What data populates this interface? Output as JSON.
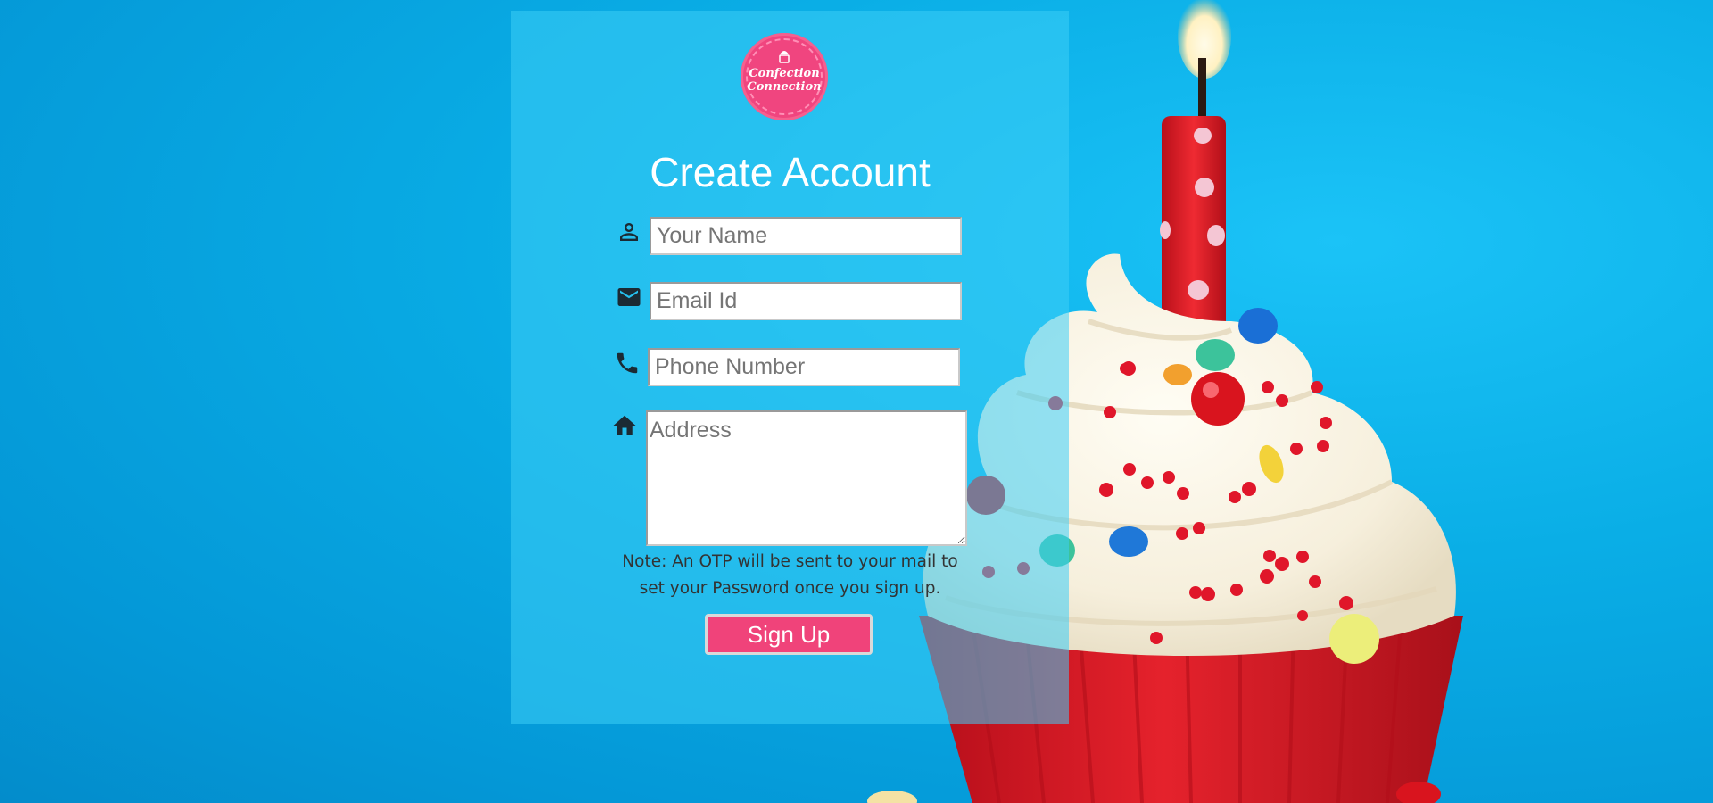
{
  "brand": {
    "logo_lines": [
      "Confection",
      "Connection"
    ],
    "logo_color": "#f0457f"
  },
  "form": {
    "title": "Create Account",
    "fields": [
      {
        "icon": "person-icon",
        "placeholder": "Your Name",
        "value": ""
      },
      {
        "icon": "mail-icon",
        "placeholder": "Email Id",
        "value": ""
      },
      {
        "icon": "phone-icon",
        "placeholder": "Phone Number",
        "value": ""
      },
      {
        "icon": "home-icon",
        "placeholder": "Address",
        "value": ""
      }
    ],
    "note_line1": "Note: An OTP will be sent to your mail to",
    "note_line2": "set your Password once you sign up.",
    "submit_label": "Sign Up"
  },
  "colors": {
    "accent": "#f0437a",
    "background": "#0aaee6",
    "card": "#3ccdf5"
  }
}
